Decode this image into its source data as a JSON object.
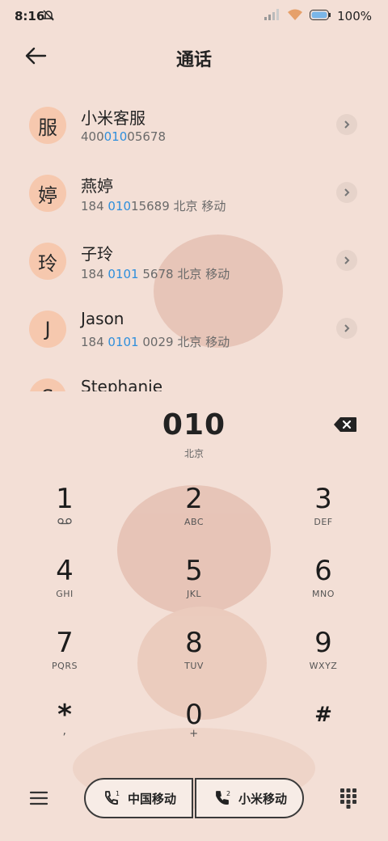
{
  "status_bar": {
    "time": "8:16",
    "battery": "100%",
    "icons": [
      "bell-off-icon",
      "signal-icon",
      "wifi-icon",
      "battery-icon"
    ]
  },
  "header": {
    "title": "通话",
    "back_icon": "back-arrow-icon"
  },
  "results": [
    {
      "avatar": "服",
      "name": "小米客服",
      "pre": "400",
      "match": "010",
      "post": "05678",
      "carrier": ""
    },
    {
      "avatar": "婷",
      "name": "燕婷",
      "pre": "184 ",
      "match": "010",
      "post": "15689",
      "carrier": "北京 移动"
    },
    {
      "avatar": "玲",
      "name": "子玲",
      "pre": "184 ",
      "match": "0101",
      "post": " 5678",
      "carrier": "北京 移动"
    },
    {
      "avatar": "J",
      "name": "Jason",
      "pre": "184 ",
      "match": "0101",
      "post": " 0029",
      "carrier": "北京 移动"
    },
    {
      "avatar": "S",
      "name": "Stephanie",
      "pre": "",
      "match": "",
      "post": "",
      "carrier": ""
    }
  ],
  "dialer": {
    "entered": "010",
    "location": "北京",
    "keys": [
      {
        "digit": "1",
        "letters": ""
      },
      {
        "digit": "2",
        "letters": "ABC"
      },
      {
        "digit": "3",
        "letters": "DEF"
      },
      {
        "digit": "4",
        "letters": "GHI"
      },
      {
        "digit": "5",
        "letters": "JKL"
      },
      {
        "digit": "6",
        "letters": "MNO"
      },
      {
        "digit": "7",
        "letters": "PQRS"
      },
      {
        "digit": "8",
        "letters": "TUV"
      },
      {
        "digit": "9",
        "letters": "WXYZ"
      },
      {
        "digit": "*",
        "letters": ","
      },
      {
        "digit": "0",
        "letters": "+"
      },
      {
        "digit": "#",
        "letters": ""
      }
    ]
  },
  "bottom": {
    "sim1_label": "中国移动",
    "sim2_label": "小米移动",
    "sim1_index": "1",
    "sim2_index": "2"
  },
  "colors": {
    "background": "#f3dfd6",
    "accent": "#2f8fdc",
    "avatar": "#f6c8ae"
  }
}
